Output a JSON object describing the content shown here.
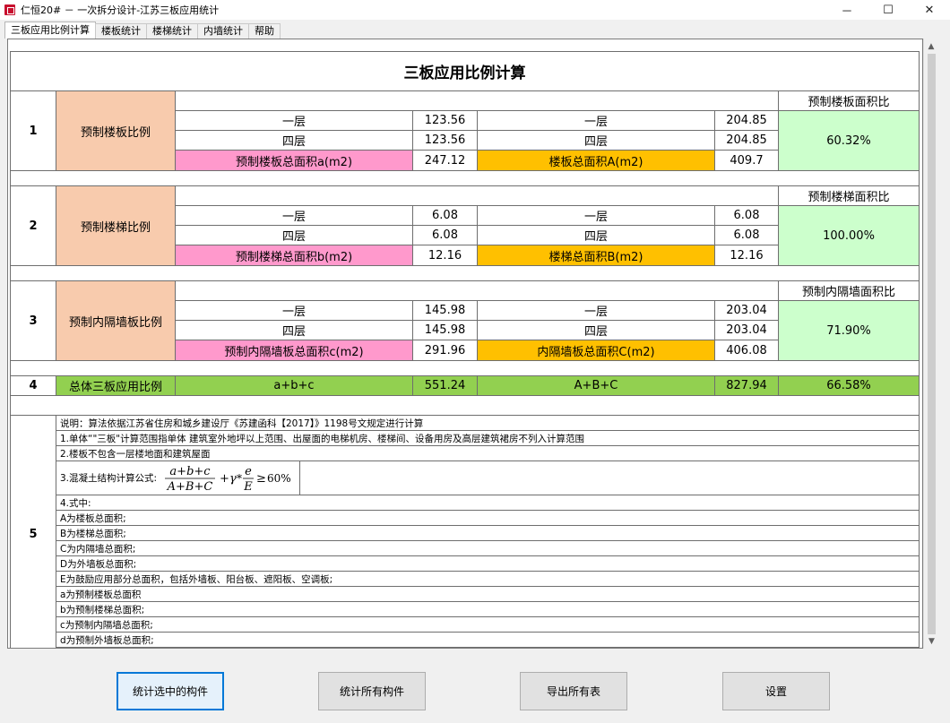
{
  "window": {
    "title": "仁恒20# － 一次拆分设计-江苏三板应用统计",
    "min": "－",
    "max": "☐",
    "close": "✕"
  },
  "tabs": [
    "三板应用比例计算",
    "楼板统计",
    "楼梯统计",
    "内墙统计",
    "帮助"
  ],
  "sheet": {
    "title": "三板应用比例计算",
    "floor": {
      "no": "1",
      "label": "预制楼板比例",
      "ratio_header": "预制楼板面积比",
      "ratio": "60.32%",
      "rows": [
        {
          "l": "一层",
          "lv": "123.56",
          "r": "一层",
          "rv": "204.85"
        },
        {
          "l": "四层",
          "lv": "123.56",
          "r": "四层",
          "rv": "204.85"
        }
      ],
      "total_left": "预制楼板总面积a(m2)",
      "total_left_v": "247.12",
      "total_right": "楼板总面积A(m2)",
      "total_right_v": "409.7"
    },
    "stair": {
      "no": "2",
      "label": "预制楼梯比例",
      "ratio_header": "预制楼梯面积比",
      "ratio": "100.00%",
      "rows": [
        {
          "l": "一层",
          "lv": "6.08",
          "r": "一层",
          "rv": "6.08"
        },
        {
          "l": "四层",
          "lv": "6.08",
          "r": "四层",
          "rv": "6.08"
        }
      ],
      "total_left": "预制楼梯总面积b(m2)",
      "total_left_v": "12.16",
      "total_right": "楼梯总面积B(m2)",
      "total_right_v": "12.16"
    },
    "wall": {
      "no": "3",
      "label": "预制内隔墙板比例",
      "ratio_header": "预制内隔墙面积比",
      "ratio": "71.90%",
      "rows": [
        {
          "l": "一层",
          "lv": "145.98",
          "r": "一层",
          "rv": "203.04"
        },
        {
          "l": "四层",
          "lv": "145.98",
          "r": "四层",
          "rv": "203.04"
        }
      ],
      "total_left": "预制内隔墙板总面积c(m2)",
      "total_left_v": "291.96",
      "total_right": "内隔墙板总面积C(m2)",
      "total_right_v": "406.08"
    },
    "total": {
      "no": "4",
      "label": "总体三板应用比例",
      "left": "a+b+c",
      "left_v": "551.24",
      "right": "A+B+C",
      "right_v": "827.94",
      "ratio": "66.58%"
    },
    "notes": {
      "no": "5",
      "lines": [
        "说明：算法依据江苏省住房和城乡建设厅《苏建函科【2017】》1198号文规定进行计算",
        "1.单体“\"三板\"计算范围指单体 建筑室外地坪以上范围、出屋面的电梯机房、楼梯间、设备用房及高层建筑裙房不列入计算范围",
        "2.楼板不包含一层楼地面和建筑屋面",
        "3.混凝土结构计算公式:",
        "4.式中:",
        "A为楼板总面积;",
        "B为楼梯总面积;",
        "C为内隔墙总面积;",
        "D为外墙板总面积;",
        "E为鼓励应用部分总面积，包括外墙板、阳台板、遮阳板、空调板;",
        "a为预制楼板总面积",
        "b为预制楼梯总面积;",
        "c为预制内隔墙总面积;",
        "d为预制外墙板总面积;"
      ],
      "formula": {
        "num": "a+b+c",
        "den": "A+B+C",
        "plus": "+",
        "gamma": "γ",
        "times": "*",
        "e_num": "e",
        "e_den": "E",
        "ge": "≥",
        "threshold": "60%"
      }
    }
  },
  "buttons": [
    "统计选中的构件",
    "统计所有构件",
    "导出所有表",
    "设置"
  ]
}
